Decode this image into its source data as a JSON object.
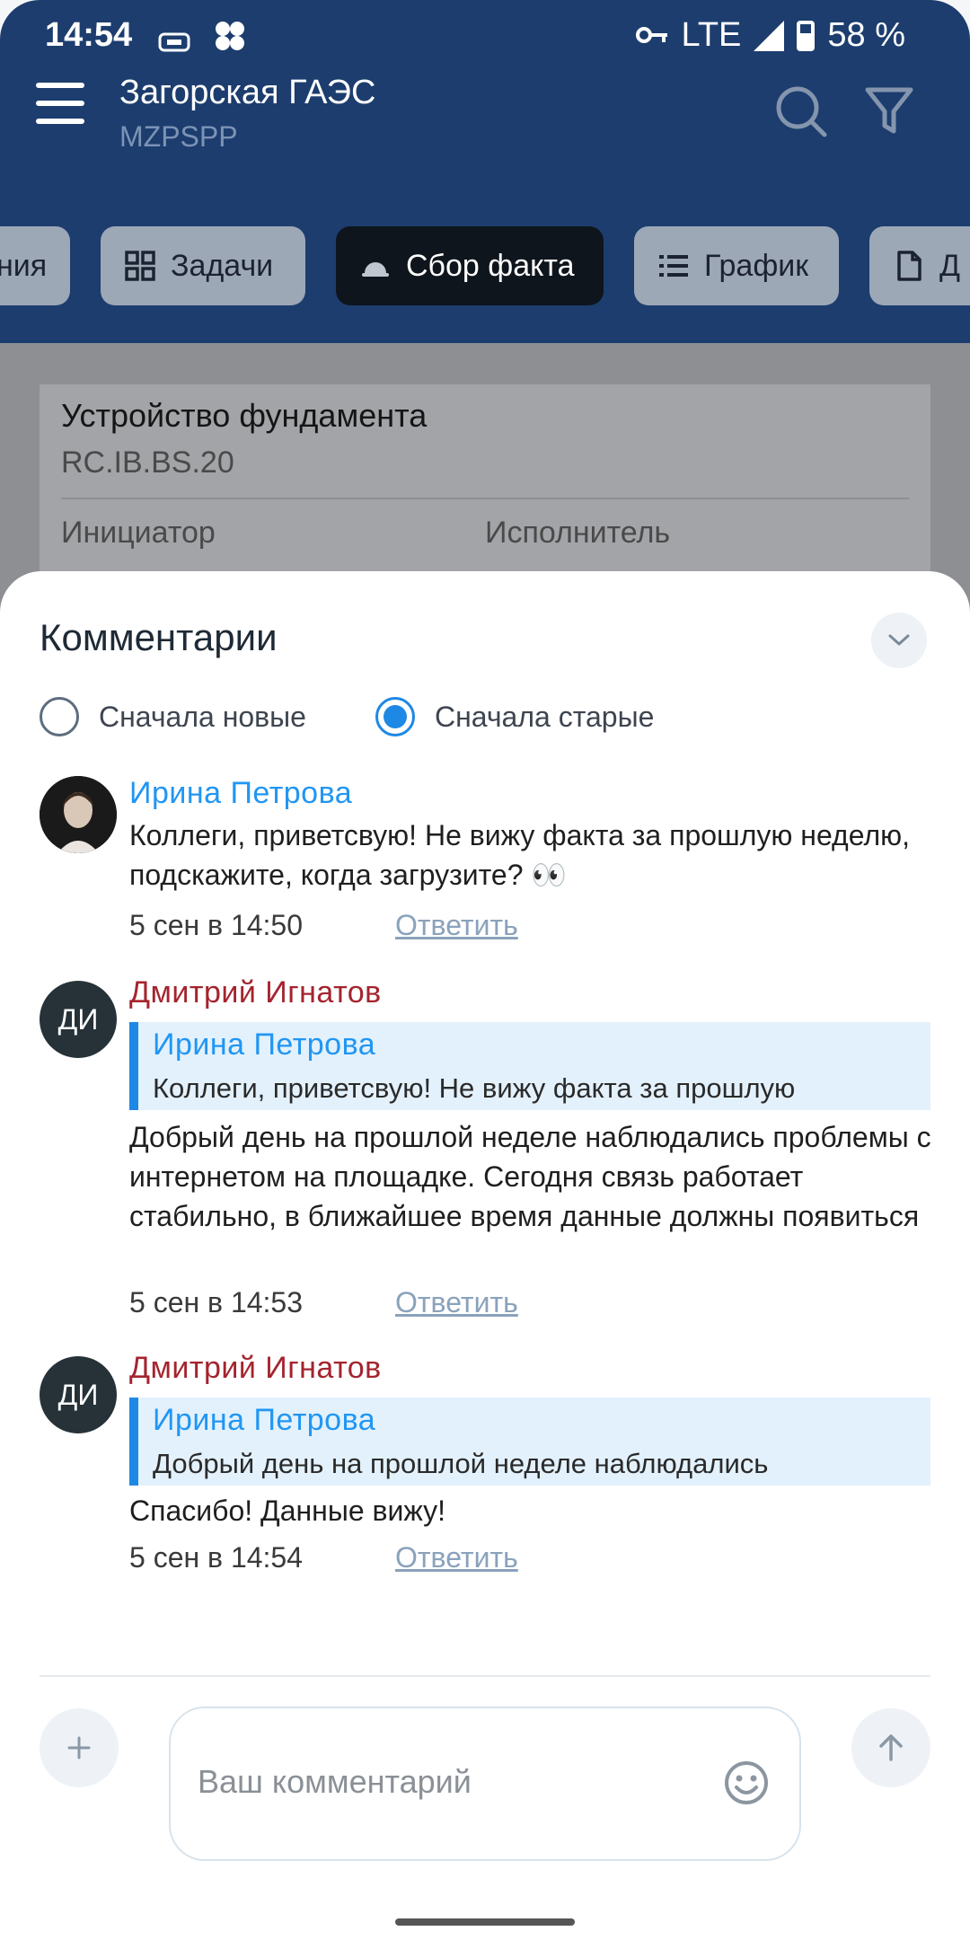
{
  "status_bar": {
    "time": "14:54",
    "network": "LTE",
    "battery": "58 %",
    "icons": [
      "sim-icon",
      "app-icon",
      "key-icon",
      "signal-icon",
      "battery-icon"
    ]
  },
  "toolbar": {
    "title": "Загорская ГАЭС",
    "subtitle": "MZPSPP"
  },
  "tabs": [
    {
      "label": "ния",
      "icon": ""
    },
    {
      "label": "Задачи",
      "icon": "grid-icon"
    },
    {
      "label": "Сбор факта",
      "icon": "hardhat-icon",
      "active": true
    },
    {
      "label": "График",
      "icon": "list-icon"
    },
    {
      "label": "Д",
      "icon": "document-icon"
    }
  ],
  "card": {
    "title": "Устройство фундамента",
    "code": "RC.IB.BS.20",
    "initiator_label": "Инициатор",
    "executor_label": "Исполнитель"
  },
  "comments_sheet": {
    "title": "Комментарии",
    "sort_options": [
      {
        "label": "Сначала новые",
        "selected": false
      },
      {
        "label": "Сначала старые",
        "selected": true
      }
    ],
    "comments": [
      {
        "author": "Ирина  Петрова",
        "avatar": "photo",
        "text": "Коллеги, приветсвую! Не вижу факта за прошлую неделю, подскажите, когда загрузите? 👀",
        "time": "5 сен в 14:50",
        "reply_label": "Ответить"
      },
      {
        "author": "Дмитрий Игнатов",
        "avatar": "ДИ",
        "quote_author": "Ирина  Петрова",
        "quote_text": "Коллеги, приветсвую! Не вижу факта за прошлую",
        "text": "Добрый день на прошлой неделе наблюдались проблемы с интернетом на площадке. Сегодня связь работает стабильно, в ближайшее время данные должны появиться",
        "time": "5 сен в 14:53",
        "reply_label": "Ответить"
      },
      {
        "author": "Дмитрий Игнатов",
        "avatar": "ДИ",
        "quote_author": "Ирина  Петрова",
        "quote_text": "Добрый день на прошлой неделе наблюдались",
        "text": "Спасибо! Данные вижу!",
        "time": "5 сен в 14:54",
        "reply_label": "Ответить"
      }
    ],
    "input_placeholder": "Ваш комментарий"
  },
  "colors": {
    "header": "#1c3d6e",
    "accent": "#2196f3",
    "author_red": "#a4242e"
  }
}
